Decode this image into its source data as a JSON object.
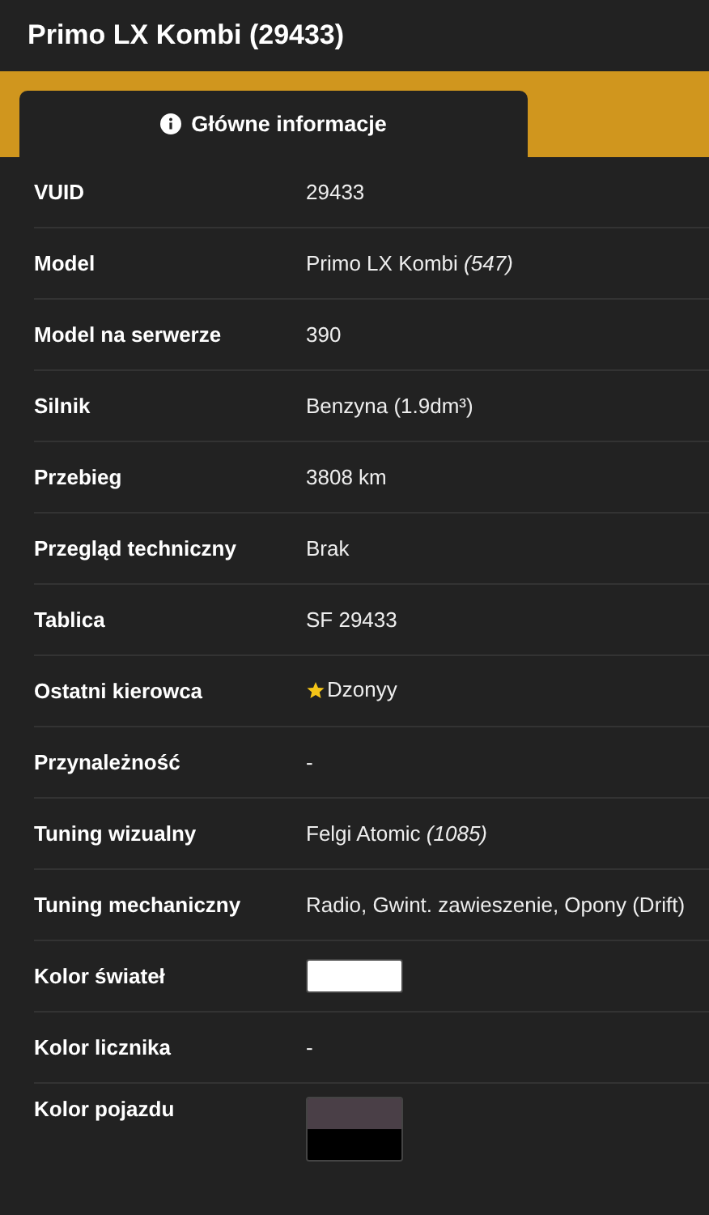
{
  "window": {
    "title": "Primo LX Kombi (29433)"
  },
  "tabs": [
    {
      "label": "Główne informacje",
      "selected": true
    }
  ],
  "rows": [
    {
      "kind": "text",
      "label": "VUID",
      "value": "29433"
    },
    {
      "kind": "text",
      "label": "Model",
      "value": "Primo LX Kombi *(547)*"
    },
    {
      "kind": "text",
      "label": "Model na serwerze",
      "value": "390"
    },
    {
      "kind": "text",
      "label": "Silnik",
      "value": "Benzyna (1.9dm³)"
    },
    {
      "kind": "text",
      "label": "Przebieg",
      "value": "3808 km"
    },
    {
      "kind": "text",
      "label": "Przegląd techniczny",
      "value": "Brak"
    },
    {
      "kind": "text",
      "label": "Tablica",
      "value": "SF 29433"
    },
    {
      "kind": "star",
      "label": "Ostatni kierowca",
      "value": "Dzonyy"
    },
    {
      "kind": "text",
      "label": "Przynależność",
      "value": "-"
    },
    {
      "kind": "text",
      "label": "Tuning wizualny",
      "value": "Felgi Atomic *(1085)*"
    },
    {
      "kind": "text",
      "label": "Tuning mechaniczny",
      "value": "Radio, Gwint. zawieszenie, Opony (Drift)"
    },
    {
      "kind": "swatch",
      "label": "Kolor świateł",
      "swatches": [
        {
          "color": "#ffffff"
        }
      ]
    },
    {
      "kind": "text",
      "label": "Kolor licznika",
      "value": "-"
    },
    {
      "kind": "swatch",
      "label": "Kolor pojazdu",
      "swatches": [
        {
          "color": "#4a3f47"
        },
        {
          "color": "#000000"
        }
      ]
    }
  ]
}
